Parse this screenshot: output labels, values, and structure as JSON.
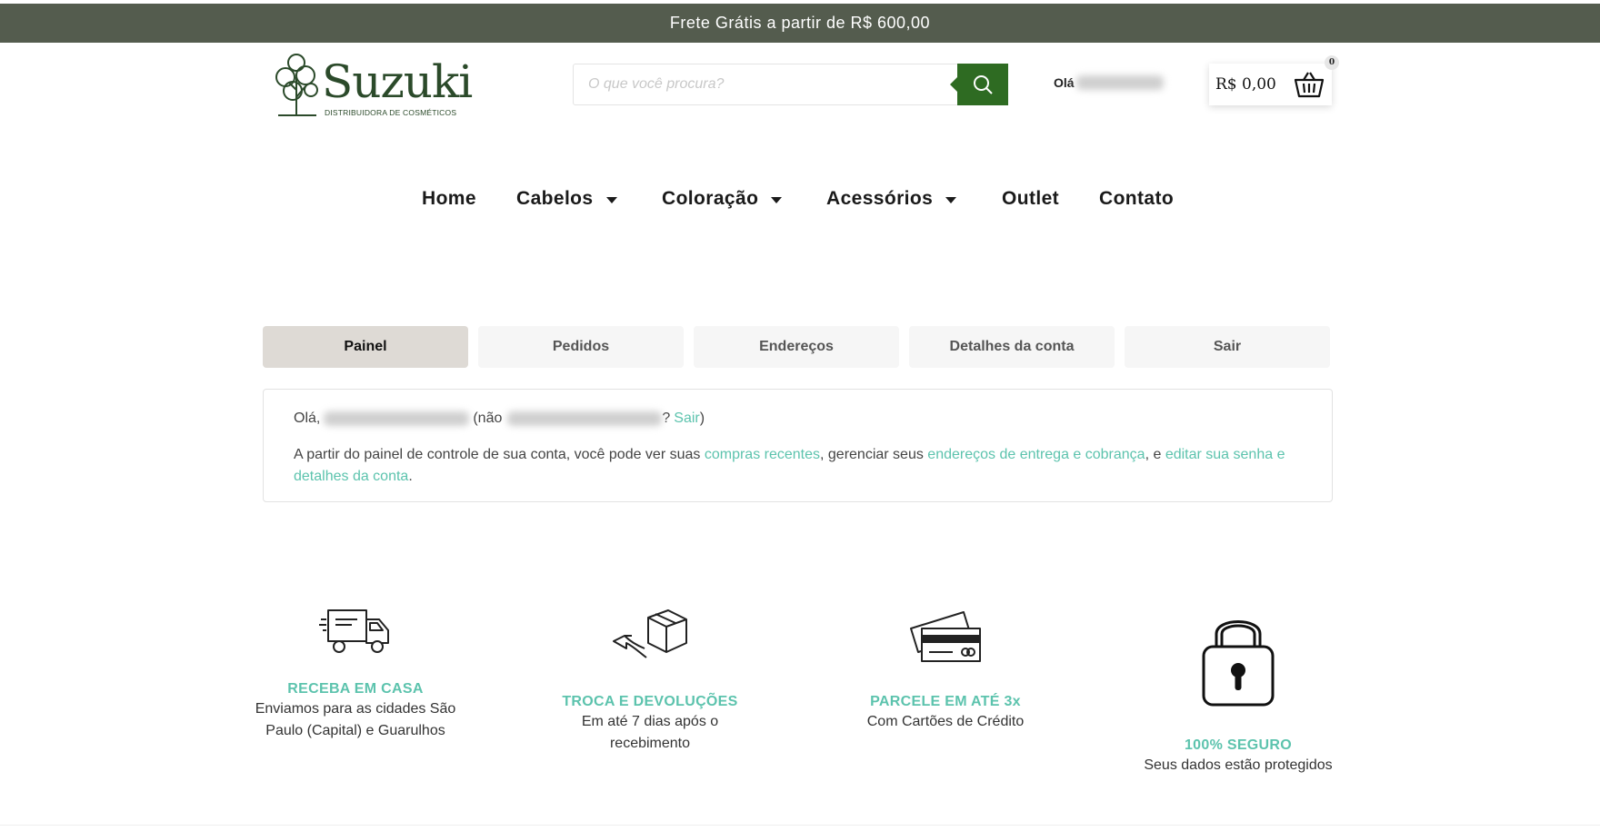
{
  "promo_bar": {
    "text": "Frete Grátis a partir de R$ 600,00"
  },
  "header": {
    "logo": {
      "brand": "Suzuki",
      "tagline": "DISTRIBUIDORA DE COSMÉTICOS"
    },
    "search": {
      "placeholder": "O que você procura?",
      "value": ""
    },
    "greeting": {
      "label": "Olá"
    },
    "cart": {
      "total": "R$ 0,00",
      "count": "0"
    }
  },
  "nav": {
    "items": [
      {
        "label": "Home"
      },
      {
        "label": "Cabelos"
      },
      {
        "label": "Coloração"
      },
      {
        "label": "Acessórios"
      },
      {
        "label": "Outlet"
      },
      {
        "label": "Contato"
      }
    ]
  },
  "account_tabs": [
    {
      "label": "Painel",
      "active": true
    },
    {
      "label": "Pedidos"
    },
    {
      "label": "Endereços"
    },
    {
      "label": "Detalhes da conta"
    },
    {
      "label": "Sair"
    }
  ],
  "dashboard": {
    "hello": "Olá,",
    "not_prefix": "(não",
    "question": "?",
    "logout_link": "Sair",
    "close_paren": ")",
    "intro_1": "A partir do painel de controle de sua conta, você pode ver suas ",
    "link_orders": "compras recentes",
    "intro_2": ", gerenciar seus ",
    "link_addresses": "endereços de entrega e cobrança",
    "intro_3": ", e ",
    "link_account": "editar sua senha e detalhes da conta",
    "intro_4": "."
  },
  "features": [
    {
      "icon": "delivery-truck-icon",
      "title": "RECEBA EM CASA",
      "desc": "Enviamos para as cidades São Paulo (Capital) e Guarulhos"
    },
    {
      "icon": "return-box-icon",
      "title": "TROCA E DEVOLUÇÕES",
      "desc": "Em até 7 dias após o recebimento"
    },
    {
      "icon": "credit-cards-icon",
      "title": "PARCELE EM ATÉ 3x",
      "desc": "Com Cartões de Crédito"
    },
    {
      "icon": "padlock-icon",
      "title": "100% SEGURO",
      "desc": "Seus dados estão protegidos"
    }
  ],
  "colors": {
    "promo_bg": "#545c4e",
    "brand_green": "#2e6b22",
    "accent_teal": "#5cc3ad",
    "active_tab": "#dedad5"
  }
}
